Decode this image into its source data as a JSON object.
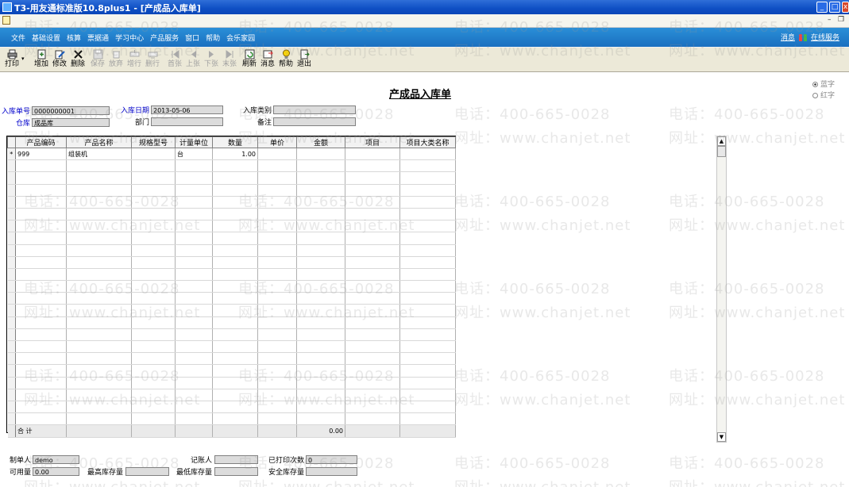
{
  "window": {
    "title": "T3-用友通标准版10.8plus1 - [产成品入库单]",
    "min": "_",
    "max": "□",
    "close": "x"
  },
  "mdi": {
    "min": "–",
    "restore": "❐"
  },
  "menu": {
    "items": [
      "文件",
      "基础设置",
      "核算",
      "票据通",
      "学习中心",
      "产品服务",
      "窗口",
      "帮助",
      "会乐家园"
    ],
    "right_message": "消息",
    "right_online": "在线服务"
  },
  "toolbar": {
    "print": "打印",
    "add": "增加",
    "edit": "修改",
    "delete": "删除",
    "save": "保存",
    "discard": "放弃",
    "insert_row": "增行",
    "delete_row": "删行",
    "first": "首张",
    "prev": "上张",
    "next": "下张",
    "last": "末张",
    "refresh": "刷新",
    "message": "消息",
    "help": "帮助",
    "exit": "退出"
  },
  "form": {
    "title": "产成品入库单",
    "radio_blue": "蓝字",
    "radio_red": "红字",
    "doc_no_label": "入库单号",
    "doc_no": "0000000001",
    "date_label": "入库日期",
    "date": "2013-05-06",
    "type_label": "入库类别",
    "type": "",
    "warehouse_label": "仓库",
    "warehouse": "成品库",
    "dept_label": "部门",
    "dept": "",
    "remark_label": "备注",
    "remark": ""
  },
  "grid": {
    "columns": [
      "产品编码",
      "产品名称",
      "规格型号",
      "计量单位",
      "数量",
      "单价",
      "金额",
      "项目",
      "项目大类名称"
    ],
    "rows": [
      {
        "marker": "*",
        "code": "999",
        "name": "组装机",
        "spec": "",
        "unit": "台",
        "qty": "1.00",
        "price": "",
        "amount": "",
        "project": "",
        "category": ""
      }
    ],
    "total_label": "合  计",
    "total_amount": "0.00"
  },
  "footer": {
    "maker_label": "制单人",
    "maker": "demo",
    "bookkeeper_label": "记账人",
    "bookkeeper": "",
    "printed_label": "已打印次数",
    "printed": "0",
    "available_label": "可用量",
    "available": "0.00",
    "max_stock_label": "最高库存量",
    "max_stock": "",
    "min_stock_label": "最低库存量",
    "min_stock": "",
    "safe_stock_label": "安全库存量",
    "safe_stock": ""
  },
  "watermark": {
    "phone": "电话：400-665-0028",
    "site": "网址：www.chanjet.net"
  },
  "colors": {
    "titlebar": "#0e4fc4",
    "menubar": "#1a6fc0",
    "label_blue": "#0000cc",
    "toolbar": "#ece9d8"
  }
}
